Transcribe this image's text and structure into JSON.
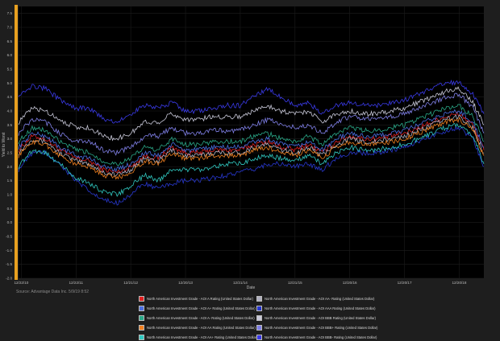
{
  "chart_data": {
    "type": "line",
    "title": "",
    "xlabel": "Date",
    "ylabel": "Yield to Worst",
    "ylim": [
      -2.0,
      7.75
    ],
    "yticks": [
      -2.0,
      -1.5,
      -1.0,
      -0.5,
      0.0,
      0.5,
      1.0,
      1.5,
      2.0,
      2.5,
      3.0,
      3.5,
      4.0,
      4.5,
      5.0,
      5.5,
      6.0,
      6.5,
      7.0,
      7.5
    ],
    "ytick_labels": [
      "-2.0",
      "-1.5",
      "-1.0",
      "-0.5",
      "0.0",
      "0.5",
      "1.0",
      "1.5",
      "2.0",
      "2.5",
      "3.0",
      "3.5",
      "4.0",
      "4.5",
      "5.0",
      "5.5",
      "6.0",
      "6.5",
      "7.0",
      "7.5"
    ],
    "x_tick_labels": [
      "12/22/10",
      "12/22/11",
      "12/21/12",
      "12/20/13",
      "12/21/14",
      "12/21/15",
      "12/20/16",
      "12/20/17",
      "12/20/18"
    ],
    "x_years": [
      2011,
      2012,
      2013,
      2014,
      2015,
      2016,
      2017,
      2018,
      2019
    ],
    "x_range": [
      2010.95,
      2019.45
    ],
    "grid": true,
    "legend_position": "bottom",
    "x": [
      2010.95,
      2011.2,
      2011.45,
      2011.7,
      2012.0,
      2012.25,
      2012.5,
      2012.75,
      2013.0,
      2013.25,
      2013.5,
      2013.75,
      2014.0,
      2014.25,
      2014.5,
      2014.75,
      2015.0,
      2015.25,
      2015.5,
      2015.75,
      2016.0,
      2016.25,
      2016.5,
      2016.75,
      2017.0,
      2017.25,
      2017.5,
      2017.75,
      2018.0,
      2018.25,
      2018.5,
      2018.75,
      2019.0,
      2019.25,
      2019.45
    ],
    "series": [
      {
        "name": "North American Investment Grade - AOI A Rating (United States Dollar)",
        "color": "#e02020",
        "values": [
          2.6,
          3.1,
          3.0,
          2.6,
          2.3,
          2.2,
          1.9,
          1.8,
          2.0,
          2.4,
          2.3,
          2.7,
          2.5,
          2.5,
          2.6,
          2.6,
          2.6,
          2.8,
          2.9,
          2.7,
          2.6,
          2.8,
          2.5,
          2.9,
          3.1,
          3.0,
          3.0,
          3.1,
          3.2,
          3.4,
          3.6,
          3.8,
          3.9,
          3.5,
          2.6
        ]
      },
      {
        "name": "North American Investment Grade - AOI AA- Rating (United States Dollar)",
        "color": "#b0b0c0",
        "values": [
          2.5,
          3.0,
          2.9,
          2.5,
          2.2,
          2.1,
          1.8,
          1.7,
          1.9,
          2.3,
          2.2,
          2.6,
          2.4,
          2.4,
          2.5,
          2.5,
          2.5,
          2.7,
          2.8,
          2.6,
          2.5,
          2.7,
          2.4,
          2.8,
          3.0,
          2.9,
          2.9,
          3.0,
          3.1,
          3.3,
          3.5,
          3.7,
          3.8,
          3.4,
          2.5
        ]
      },
      {
        "name": "North American Investment Grade - AOI A+ Rating (United States Dollar)",
        "color": "#4a6ee0",
        "values": [
          2.7,
          3.2,
          3.1,
          2.7,
          2.4,
          2.3,
          2.0,
          1.9,
          2.1,
          2.5,
          2.4,
          2.8,
          2.6,
          2.6,
          2.7,
          2.7,
          2.7,
          2.9,
          3.0,
          2.8,
          2.7,
          2.9,
          2.6,
          3.0,
          3.2,
          3.1,
          3.1,
          3.2,
          3.3,
          3.5,
          3.7,
          3.9,
          4.0,
          3.6,
          2.7
        ]
      },
      {
        "name": "North American Investment Grade - AOI AAA Rating (United States Dollar)",
        "color": "#2838d0",
        "values": [
          1.9,
          2.5,
          2.5,
          2.1,
          1.5,
          1.1,
          0.8,
          0.7,
          1.0,
          1.4,
          1.2,
          1.4,
          1.5,
          1.5,
          1.6,
          1.7,
          1.8,
          1.9,
          2.1,
          2.1,
          2.0,
          2.1,
          1.9,
          2.3,
          2.5,
          2.5,
          2.5,
          2.6,
          2.7,
          2.9,
          3.1,
          3.3,
          3.4,
          3.0,
          2.0
        ]
      },
      {
        "name": "North American Investment Grade - AOI A- Rating (United States Dollar)",
        "color": "#2aa888",
        "values": [
          2.9,
          3.4,
          3.3,
          2.9,
          2.6,
          2.5,
          2.2,
          2.1,
          2.3,
          2.7,
          2.6,
          3.0,
          2.8,
          2.8,
          2.9,
          2.9,
          2.9,
          3.1,
          3.2,
          3.0,
          2.9,
          3.1,
          2.8,
          3.2,
          3.4,
          3.3,
          3.3,
          3.4,
          3.5,
          3.7,
          3.9,
          4.1,
          4.2,
          3.8,
          2.9
        ]
      },
      {
        "name": "North American Investment Grade - AOI BBB Rating (United States Dollar)",
        "color": "#c8c8d8",
        "values": [
          3.6,
          4.1,
          4.0,
          3.7,
          3.4,
          3.4,
          3.1,
          3.0,
          3.2,
          3.6,
          3.6,
          3.9,
          3.7,
          3.7,
          3.8,
          3.8,
          3.8,
          4.0,
          4.2,
          4.0,
          3.9,
          4.0,
          3.6,
          3.9,
          4.0,
          3.9,
          3.9,
          4.0,
          4.1,
          4.3,
          4.5,
          4.7,
          4.8,
          4.3,
          3.5
        ]
      },
      {
        "name": "North American Investment Grade - AOI AA Rating (United States Dollar)",
        "color": "#f08020",
        "values": [
          2.4,
          2.9,
          2.8,
          2.4,
          2.1,
          2.0,
          1.7,
          1.6,
          1.8,
          2.2,
          2.1,
          2.5,
          2.3,
          2.3,
          2.4,
          2.4,
          2.4,
          2.6,
          2.7,
          2.5,
          2.4,
          2.6,
          2.3,
          2.7,
          2.9,
          2.8,
          2.8,
          2.9,
          3.0,
          3.2,
          3.4,
          3.6,
          3.7,
          3.3,
          2.4
        ]
      },
      {
        "name": "North American Investment Grade - AOI BBB+ Rating (United States Dollar)",
        "color": "#8080e8",
        "values": [
          3.2,
          3.7,
          3.6,
          3.2,
          2.9,
          2.9,
          2.6,
          2.5,
          2.7,
          3.1,
          3.1,
          3.4,
          3.2,
          3.2,
          3.3,
          3.3,
          3.3,
          3.5,
          3.7,
          3.5,
          3.4,
          3.5,
          3.2,
          3.6,
          3.8,
          3.7,
          3.7,
          3.8,
          3.9,
          4.1,
          4.3,
          4.5,
          4.6,
          4.1,
          3.2
        ]
      },
      {
        "name": "North American Investment Grade - AOI AA+ Rating (United States Dollar)",
        "color": "#30c8c0",
        "values": [
          2.0,
          2.6,
          2.5,
          2.1,
          1.6,
          1.4,
          1.1,
          1.0,
          1.3,
          1.7,
          1.5,
          1.9,
          1.9,
          1.9,
          2.0,
          2.1,
          2.1,
          2.3,
          2.4,
          2.3,
          2.2,
          2.4,
          2.1,
          2.5,
          2.7,
          2.6,
          2.6,
          2.7,
          2.8,
          3.0,
          3.2,
          3.4,
          3.5,
          3.1,
          2.1
        ]
      },
      {
        "name": "North American Investment Grade - AOI BBB- Rating (United States Dollar)",
        "color": "#3a3ae8",
        "values": [
          4.6,
          4.9,
          4.8,
          4.4,
          4.1,
          4.1,
          3.7,
          3.6,
          3.9,
          4.2,
          4.1,
          4.3,
          4.0,
          4.0,
          4.1,
          4.2,
          4.2,
          4.5,
          4.8,
          4.5,
          4.2,
          4.3,
          3.9,
          4.2,
          4.3,
          4.2,
          4.2,
          4.3,
          4.4,
          4.6,
          4.8,
          5.0,
          5.0,
          4.6,
          3.9
        ]
      }
    ]
  },
  "source_text": "Source: Advantage Data Inc. 5/9/19 8:52"
}
